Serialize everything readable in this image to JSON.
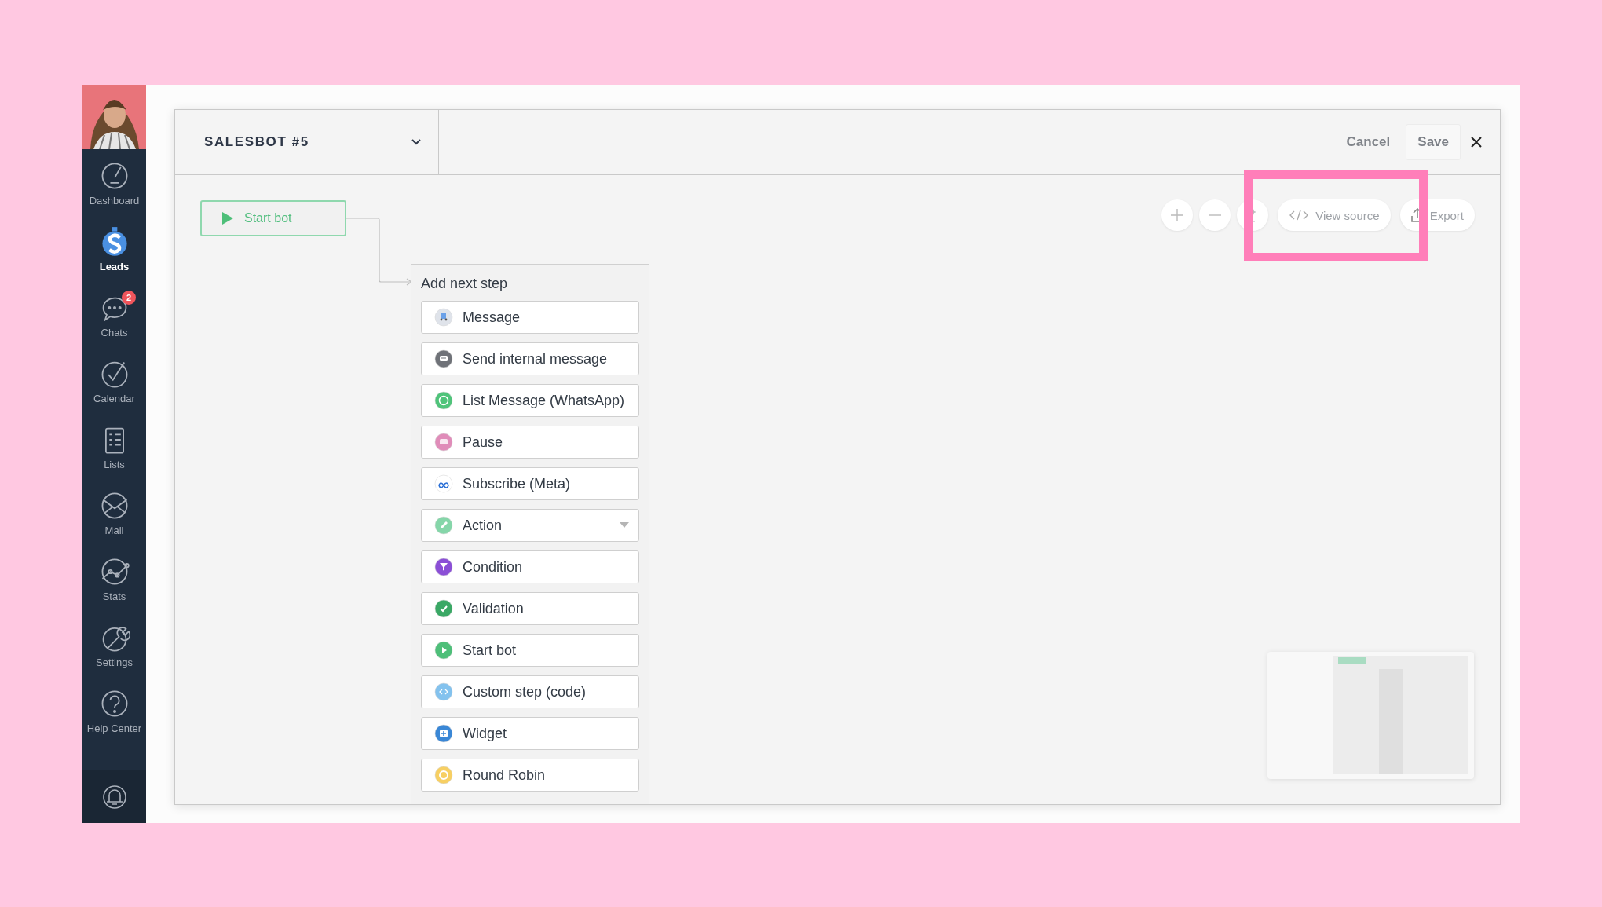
{
  "sidebar": {
    "items": [
      {
        "label": "Dashboard",
        "selected": false
      },
      {
        "label": "Leads",
        "selected": true
      },
      {
        "label": "Chats",
        "selected": false,
        "badge": "2"
      },
      {
        "label": "Calendar",
        "selected": false
      },
      {
        "label": "Lists",
        "selected": false
      },
      {
        "label": "Mail",
        "selected": false
      },
      {
        "label": "Stats",
        "selected": false
      },
      {
        "label": "Settings",
        "selected": false
      },
      {
        "label": "Help Center",
        "selected": false
      }
    ]
  },
  "editor": {
    "title": "SALESBOT #5",
    "buttons": [
      "Cancel",
      "Save"
    ],
    "toolbar": {
      "view_source": "View source",
      "export": "Export"
    },
    "start_node": {
      "label": "Start bot"
    },
    "step_panel": {
      "title": "Add next step",
      "steps": [
        {
          "label": "Message",
          "kind": "step",
          "color": "#dfe3ea"
        },
        {
          "label": "Send internal message",
          "kind": "step",
          "color": "#6f7278"
        },
        {
          "label": "List Message (WhatsApp)",
          "kind": "step",
          "color": "#4fc47a"
        },
        {
          "label": "Pause",
          "kind": "step",
          "color": "#e08cb9"
        },
        {
          "label": "Subscribe (Meta)",
          "kind": "step",
          "color": "#ffffff"
        },
        {
          "label": "Action",
          "kind": "dropdown",
          "color": "#85d6a9"
        },
        {
          "label": "Condition",
          "kind": "step",
          "color": "#8b4fd6"
        },
        {
          "label": "Validation",
          "kind": "step",
          "color": "#3aa865"
        },
        {
          "label": "Start bot",
          "kind": "step",
          "color": "#4ebf79"
        },
        {
          "label": "Custom step (code)",
          "kind": "step",
          "color": "#83c2ee"
        },
        {
          "label": "Widget",
          "kind": "step",
          "color": "#3a87d6"
        },
        {
          "label": "Round Robin",
          "kind": "step",
          "color": "#f7cf62"
        }
      ]
    }
  }
}
